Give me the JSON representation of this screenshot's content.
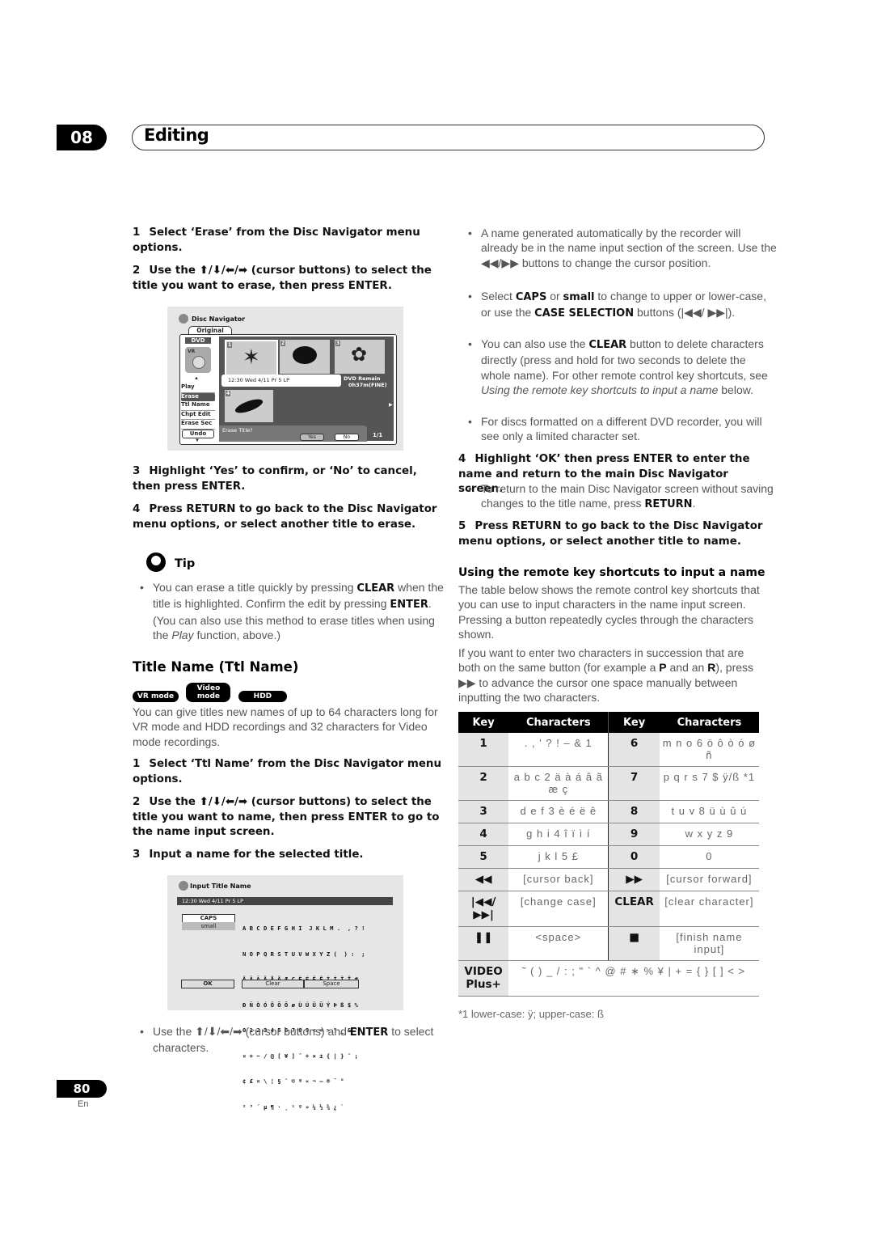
{
  "header": {
    "chapter_number": "08",
    "chapter_title": "Editing"
  },
  "left": {
    "erase_steps": [
      {
        "num": "1",
        "text": "Select ‘Erase’ from the Disc Navigator menu options."
      },
      {
        "num": "2",
        "text": "Use the ⬆/⬇/⬅/➡ (cursor buttons) to select the title you want to erase, then press ENTER."
      }
    ],
    "disc_nav": {
      "title": "Disc Navigator",
      "tab": "Original",
      "media": "DVD",
      "mode_label": "VR",
      "menu": [
        "Play",
        "Erase",
        "Ttl Name",
        "Chpt Edit",
        "Erase Sec"
      ],
      "selected_menu": "Erase",
      "undo": "Undo",
      "thumb_numbers": [
        "1",
        "2",
        "3",
        "4"
      ],
      "info": "12:30 Wed  4/11  Pr 5   LP",
      "remain_label": "DVD Remain",
      "remain_value": "0h37m(FINE)",
      "prompt": "Erase Title?",
      "yes": "Yes",
      "no": "No",
      "page": "1/1"
    },
    "erase_steps_2": [
      {
        "num": "3",
        "text": "Highlight ‘Yes’ to confirm, or ‘No’ to cancel, then press ENTER."
      },
      {
        "num": "4",
        "text": "Press RETURN to go back to the Disc Navigator menu options, or select another title to erase."
      }
    ],
    "tip": {
      "label": "Tip",
      "t1": "You can erase a title quickly by pressing ",
      "b1": "CLEAR",
      "t2": " when the title is highlighted. Confirm the edit by pressing ",
      "b2": "ENTER",
      "t3": ". (You can also use this method to erase titles when using the ",
      "i1": "Play",
      "t4": " function, above.)"
    },
    "section_title": "Title Name (Ttl Name)",
    "badges": [
      "VR mode",
      "Video mode",
      "HDD"
    ],
    "intro": "You can give titles new names of up to 64 characters long for VR mode and HDD recordings and 32 characters for Video mode recordings.",
    "name_steps": [
      {
        "num": "1",
        "text": "Select ‘Ttl Name’ from the Disc Navigator menu options."
      },
      {
        "num": "2",
        "text": "Use the ⬆/⬇/⬅/➡ (cursor buttons) to select the title you want to name, then press ENTER to go to the name input screen."
      },
      {
        "num": "3",
        "text": "Input a name for the selected title."
      }
    ],
    "input_screen": {
      "title": "Input Title Name",
      "info": "12:30 Wed  4/11   Pr 5   LP",
      "caps": "CAPS",
      "small": "small",
      "char_rows": [
        "A B C D E F G H I  J K L M .  , ? !",
        "N O P Q R S T U V W X Y Z (  ) :  ;",
        "Ä Â Ã Ä Å Ä Æ Ç È É Ê Ë Ì Í Î Ï #",
        "Ð Ñ Ò Ó Ô Õ Ö ø Ù Ú Û Ü Ý Þ ß $ %",
        "0 1 2 3 4 5 6 7 8 9 < = > \" _ & '",
        "¤ + − / @ [ ¥ ] ˆ ÷ × ± { | } ˜ ¡",
        "¢ £ ¤ \\ ¦ § ¨ © ª « ¬ – ® ¯ °",
        "² ³ ´ µ ¶ · ¸ ¹ º » ¼ ½ ¾ ¿ `"
      ],
      "ok": "OK",
      "clear": "Clear",
      "space": "Space"
    },
    "final_bullet": {
      "t1": "Use the ⬆/⬇/⬅/➡ (cursor buttons) and ",
      "b1": "ENTER",
      "t2": " to select characters."
    }
  },
  "right": {
    "bullets": [
      {
        "t1": "A name generated automatically by the recorder will already be in the name input section of the screen. Use the ◀◀/▶▶ buttons to change the cursor position."
      },
      {
        "t1": "Select ",
        "b1": "CAPS",
        "t2": " or ",
        "b2": "small",
        "t3": " to change to upper or lower-case, or use the ",
        "b3": "CASE SELECTION",
        "t4": " buttons (|◀◀/ ▶▶|)."
      },
      {
        "t1": "You can also use the ",
        "b1": "CLEAR",
        "t2": " button to delete characters directly (press and hold for two seconds to delete the whole name). For other remote control key shortcuts, see ",
        "i1": "Using the remote key shortcuts to input a name",
        "t3": " below."
      },
      {
        "t1": "For discs formatted on a different DVD recorder, you will see only a limited character set."
      }
    ],
    "step4": {
      "num": "4",
      "text": "Highlight ‘OK’ then press ENTER to enter the name and return to the main Disc Navigator screen."
    },
    "step4_bullet": {
      "t1": "To return to the main Disc Navigator screen without saving changes to the title name, press ",
      "b1": "RETURN",
      "t2": "."
    },
    "step5": {
      "num": "5",
      "text": "Press RETURN to go back to the Disc Navigator menu options, or select another title to name."
    },
    "shortcuts_heading": "Using the remote key shortcuts to input a name",
    "para1": "The table below shows the remote control key shortcuts that you can use to input characters in the name input screen. Pressing a button repeatedly cycles through the characters shown.",
    "para2": {
      "t1": "If you want to enter two characters in succession that are both on the same button (for example a ",
      "b1": "P",
      "t2": " and an ",
      "b2": "R",
      "t3": "), press ▶▶ to advance the cursor one space manually between inputting the two characters."
    },
    "table": {
      "headers": [
        "Key",
        "Characters",
        "Key",
        "Characters"
      ],
      "rows": [
        [
          "1",
          ". , ' ? ! – & 1",
          "6",
          "m n o 6 ö ô ò ó ø ñ"
        ],
        [
          "2",
          "a b c 2 ä à á â ã æ ç",
          "7",
          "p q r s 7 $ ÿ/ß *1"
        ],
        [
          "3",
          "d e f 3 è é ë ê",
          "8",
          "t u v 8 ü ù û ú"
        ],
        [
          "4",
          "g h i 4 î ï ì í",
          "9",
          "w x y z 9"
        ],
        [
          "5",
          "j k l 5 £",
          "0",
          "0"
        ],
        [
          "◀◀",
          "[cursor back]",
          "▶▶",
          "[cursor forward]"
        ],
        [
          "|◀◀/ ▶▶|",
          "[change case]",
          "CLEAR",
          "[clear character]"
        ],
        [
          "❚❚",
          "<space>",
          "■",
          "[finish name input]"
        ]
      ],
      "last_row": {
        "key": "VIDEO Plus+",
        "chars": "˜ ( ) _ / : ; \" ` ^ @ # ∗ % ¥ | + = { } [ ] < >"
      }
    },
    "footnote": "*1 lower-case: ÿ; upper-case: ß"
  },
  "footer": {
    "page_number": "80",
    "lang": "En"
  }
}
